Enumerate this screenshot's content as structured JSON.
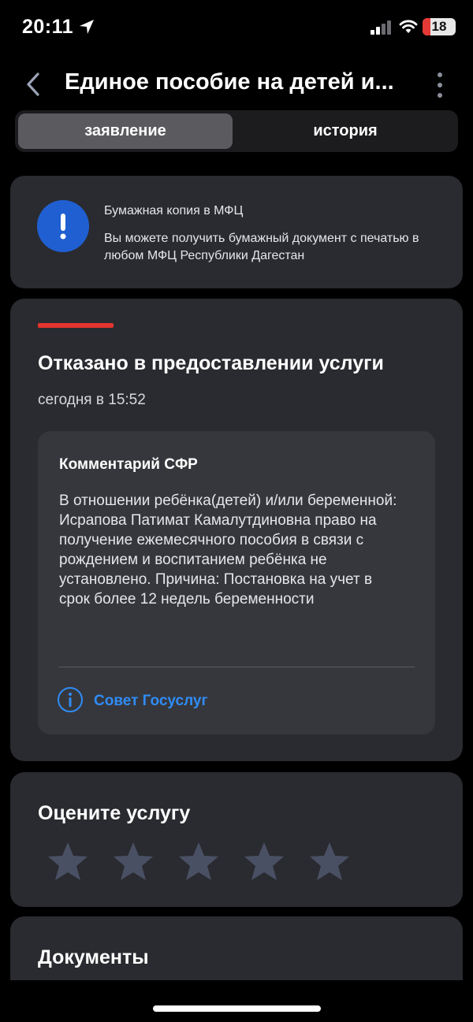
{
  "status_bar": {
    "time": "20:11",
    "battery_level": "18",
    "icons": [
      "location-arrow-icon",
      "cellular-signal-icon",
      "wifi-icon",
      "battery-icon"
    ]
  },
  "header": {
    "title": "Единое пособие на детей и...",
    "back_icon": "chevron-left-icon",
    "menu_icon": "more-vertical-icon"
  },
  "tabs": [
    {
      "label": "заявление",
      "selected": true
    },
    {
      "label": "история",
      "selected": false
    }
  ],
  "info": {
    "icon": "exclamation-icon",
    "title": "Бумажная копия в МФЦ",
    "text": "Вы можете получить бумажный документ с печатью в любом МФЦ Республики Дагестан"
  },
  "application_status": {
    "status": "Отказано в предоставлении услуги",
    "date": "сегодня в 15:52",
    "status_color": "#e5352f",
    "comment": {
      "title": "Комментарий СФР",
      "text": "В отношении ребёнка(детей) и/или беременной: Исрапова Патимат Камалутдиновна право на получение ежемесячного пособия в связи с рождением и воспитанием ребёнка не установлено. Причина: Постановка на учет в срок более 12 недель беременности"
    },
    "advice_link": "Совет Госуслуг",
    "advice_icon": "info-circle-icon"
  },
  "rating": {
    "title": "Оцените услугу",
    "max_stars": 5,
    "value": 0
  },
  "documents": {
    "title": "Документы"
  },
  "colors": {
    "accent": "#2f8cf5",
    "card": "#2a2b30",
    "info_icon_bg": "#1f5fd1",
    "star": "#4a5064"
  }
}
